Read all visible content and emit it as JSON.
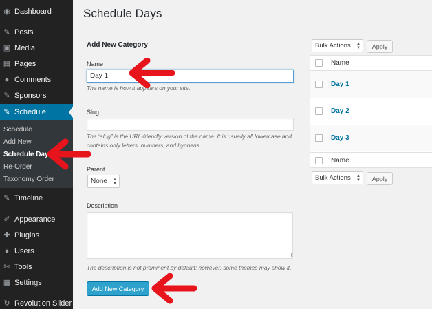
{
  "sidebar": {
    "items": [
      {
        "label": "Dashboard",
        "icon": "dashboard-icon",
        "glyph": "◉"
      },
      {
        "label": "Posts",
        "icon": "pushpin-icon",
        "glyph": "✎"
      },
      {
        "label": "Media",
        "icon": "media-icon",
        "glyph": "▣"
      },
      {
        "label": "Pages",
        "icon": "pages-icon",
        "glyph": "▤"
      },
      {
        "label": "Comments",
        "icon": "comments-icon",
        "glyph": "●"
      },
      {
        "label": "Sponsors",
        "icon": "pushpin-icon",
        "glyph": "✎"
      },
      {
        "label": "Schedule",
        "icon": "pushpin-icon",
        "glyph": "✎"
      },
      {
        "label": "Timeline",
        "icon": "pushpin-icon",
        "glyph": "✎"
      },
      {
        "label": "Appearance",
        "icon": "appearance-icon",
        "glyph": "✐"
      },
      {
        "label": "Plugins",
        "icon": "plugins-icon",
        "glyph": "✚"
      },
      {
        "label": "Users",
        "icon": "users-icon",
        "glyph": "●"
      },
      {
        "label": "Tools",
        "icon": "tools-icon",
        "glyph": "✄"
      },
      {
        "label": "Settings",
        "icon": "settings-icon",
        "glyph": "▦"
      },
      {
        "label": "Revolution Slider",
        "icon": "slider-icon",
        "glyph": "↻"
      }
    ],
    "submenu": [
      "Schedule",
      "Add New",
      "Schedule Days",
      "Re-Order",
      "Taxonomy Order"
    ]
  },
  "page": {
    "title": "Schedule Days"
  },
  "form": {
    "heading": "Add New Category",
    "name_label": "Name",
    "name_value": "Day 1",
    "name_help": "The name is how it appears on your site.",
    "slug_label": "Slug",
    "slug_value": "",
    "slug_help_1": "The “slug” is the URL-friendly version of the name. It is usually all lowercase and",
    "slug_help_2": "contains only letters, numbers, and hyphens.",
    "parent_label": "Parent",
    "parent_value": "None",
    "description_label": "Description",
    "description_help": "The description is not prominent by default; however, some themes may show it.",
    "submit_label": "Add New Category"
  },
  "table": {
    "bulk_label": "Bulk Actions",
    "apply_label": "Apply",
    "column_name": "Name",
    "rows": [
      "Day 1",
      "Day 2",
      "Day 3"
    ]
  },
  "colors": {
    "sidebar": "#222222",
    "active": "#0074a2",
    "button": "#2ea2cc",
    "arrow": "#e8141c"
  }
}
